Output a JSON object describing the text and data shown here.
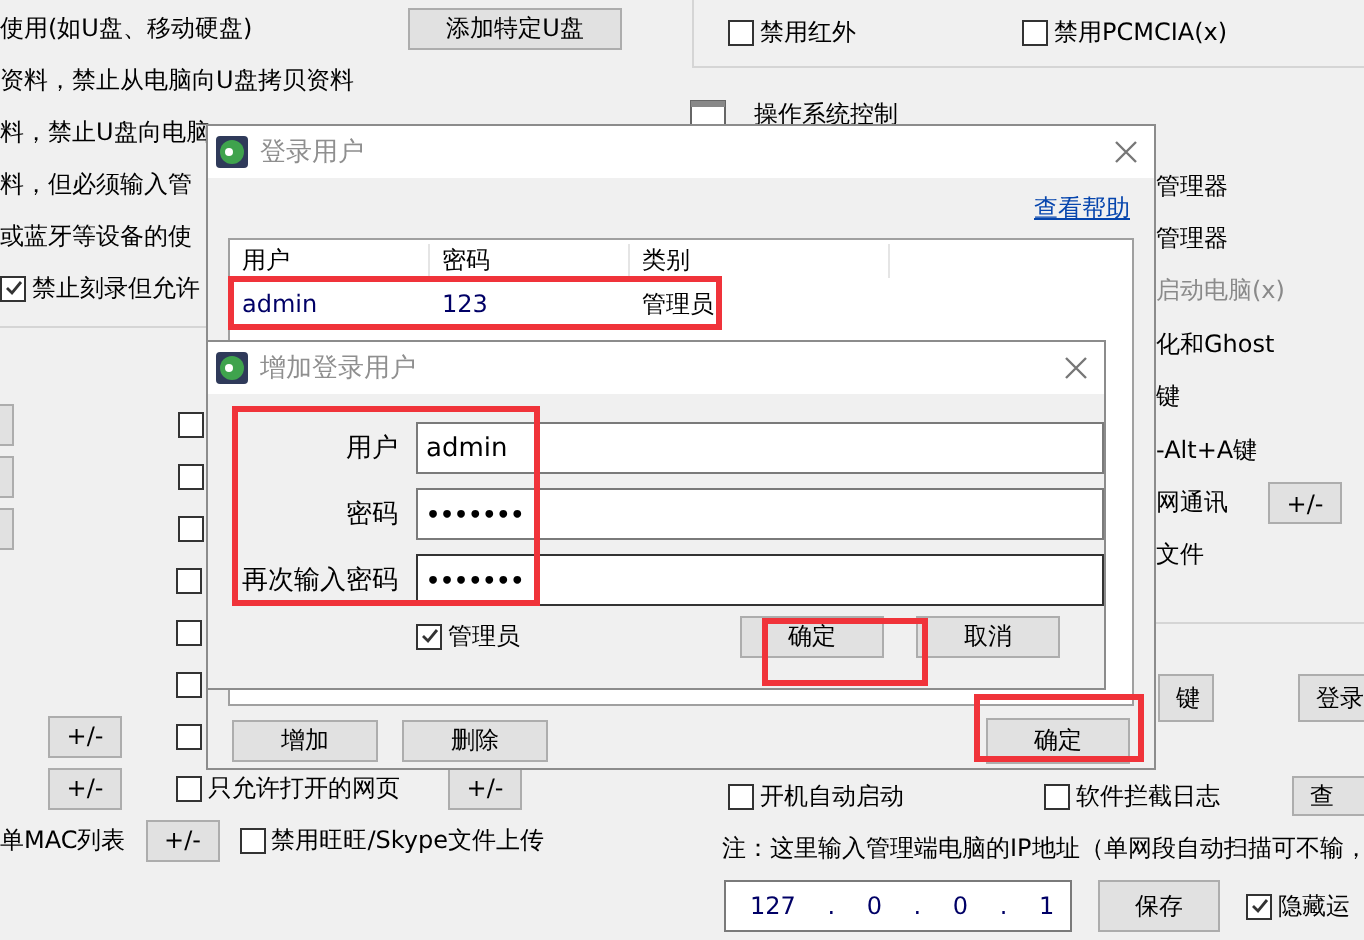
{
  "background": {
    "usb_row": {
      "text": "使用(如U盘、移动硬盘)",
      "button": "添加特定U盘"
    },
    "left_lines": [
      "资料，禁止从电脑向U盘拷贝资料",
      "料，禁止U盘向电脑",
      "料，但必须输入管",
      "或蓝牙等设备的使"
    ],
    "burn_option": {
      "label": "禁止刻录但允许",
      "checked": true
    },
    "left_rows": [
      {
        "kind": "edge_button",
        "checked": false
      },
      {
        "kind": "edge_button",
        "checked": false
      },
      {
        "kind": "edge_button",
        "checked": false
      },
      {
        "kind": "plain",
        "checked": false
      },
      {
        "kind": "plain",
        "checked": false
      },
      {
        "kind": "plain",
        "checked": false
      },
      {
        "kind": "plus",
        "button": "+/-",
        "checked": false
      },
      {
        "kind": "plus",
        "button": "+/-",
        "checked": false,
        "label": "只允许打开的网页",
        "right_button": "+/-"
      },
      {
        "kind": "mac",
        "text": "单MAC列表",
        "button": "+/-",
        "checked": false,
        "label": "禁用旺旺/Skype文件上传"
      }
    ],
    "device_options": [
      {
        "label": "禁用红外",
        "checked": false
      },
      {
        "label": "禁用PCMCIA(x)",
        "checked": false
      }
    ],
    "section_title": "操作系统控制",
    "os_items": [
      {
        "text": "管理器",
        "disabled": false
      },
      {
        "text": "管理器",
        "disabled": false
      },
      {
        "text": "启动电脑(x)",
        "disabled": true
      },
      {
        "text": "化和Ghost",
        "disabled": false
      },
      {
        "text": "键",
        "disabled": false
      },
      {
        "text": "-Alt+A键",
        "disabled": false
      },
      {
        "text": "网通讯",
        "disabled": false,
        "button": "+/-"
      },
      {
        "text": "文件",
        "disabled": false
      }
    ],
    "action_buttons": [
      "键",
      "登录"
    ],
    "startup_options": [
      {
        "label": "开机自动启动",
        "checked": false
      },
      {
        "label": "软件拦截日志",
        "checked": false
      }
    ],
    "query_button": "查",
    "note": "注：这里输入管理端电脑的IP地址（单网段自动扫描可不输，",
    "ip_address": "127 . 0 . 0 . 1",
    "save_button": "保存",
    "hide_option": {
      "label": "隐藏运",
      "checked": true
    }
  },
  "login_dialog": {
    "title": "登录用户",
    "help_link": "查看帮助",
    "columns": [
      "用户",
      "密码",
      "类别"
    ],
    "rows": [
      {
        "cells": [
          "admin",
          "123",
          "管理员"
        ]
      }
    ],
    "buttons": [
      "增加",
      "删除"
    ],
    "ok_button": "确定"
  },
  "add_dialog": {
    "title": "增加登录用户",
    "fields": [
      {
        "label": "用户",
        "value": "admin",
        "kind": "text"
      },
      {
        "label": "密码",
        "value": "•••••••",
        "kind": "password"
      },
      {
        "label": "再次输入密码",
        "value": "•••••••",
        "kind": "password"
      }
    ],
    "admin_option": {
      "label": "管理员",
      "checked": true
    },
    "ok_button": "确定",
    "cancel_button": "取消"
  }
}
